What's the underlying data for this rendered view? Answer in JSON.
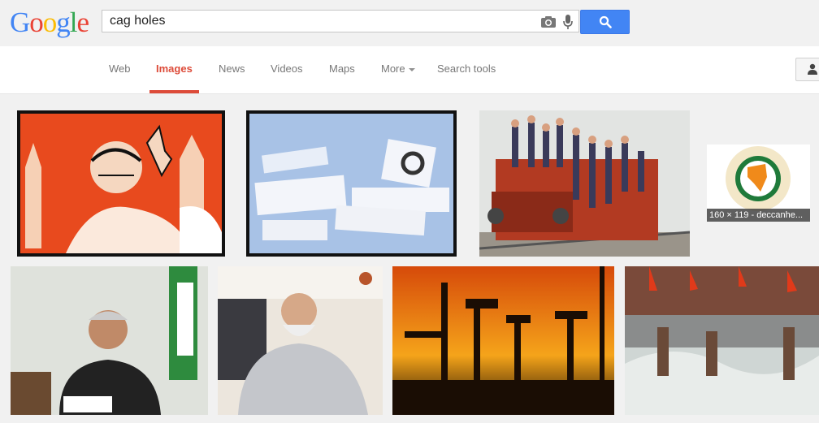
{
  "header": {
    "logo_letters": [
      "G",
      "o",
      "o",
      "g",
      "l",
      "e"
    ],
    "logo_colors": [
      "#4285f4",
      "#ea4335",
      "#fbbc05",
      "#4285f4",
      "#34a853",
      "#ea4335"
    ],
    "search_query": "cag holes"
  },
  "nav": {
    "tabs": [
      {
        "label": "Web",
        "active": false
      },
      {
        "label": "Images",
        "active": true
      },
      {
        "label": "News",
        "active": false
      },
      {
        "label": "Videos",
        "active": false
      },
      {
        "label": "Maps",
        "active": false
      },
      {
        "label": "More",
        "active": false
      },
      {
        "label": "Search tools",
        "active": false
      }
    ]
  },
  "results": {
    "hover_caption": "160 × 119 - deccanhe..."
  },
  "colors": {
    "accent": "#dd4b39",
    "search_button": "#4285f4"
  },
  "icons": [
    "camera-icon",
    "microphone-icon",
    "search-icon",
    "account-icon",
    "caret-down-icon"
  ]
}
